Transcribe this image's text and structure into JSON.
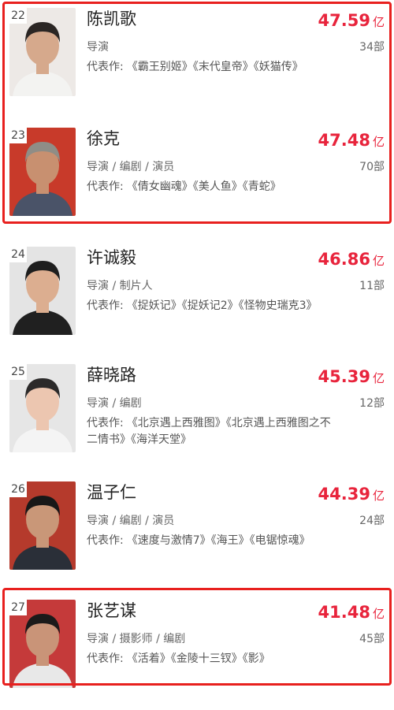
{
  "works_label": "代表作:",
  "box_office_unit": "亿",
  "highlight_color": "#e8201e",
  "value_color": "#e8243c",
  "entries": [
    {
      "rank": "22",
      "name": "陈凯歌",
      "box_office": "47.59",
      "roles": "导演",
      "count": "34部",
      "works": "《霸王别姬》《末代皇帝》《妖猫传》",
      "photo_bg": "#ede9e6",
      "hair": "#2b2624",
      "skin": "#d6a98c",
      "shirt": "#f3f3f1"
    },
    {
      "rank": "23",
      "name": "徐克",
      "box_office": "47.48",
      "roles": "导演 / 编剧 / 演员",
      "count": "70部",
      "works": "《倩女幽魂》《美人鱼》《青蛇》",
      "photo_bg": "#c83a2a",
      "hair": "#8f8d86",
      "skin": "#c89070",
      "shirt": "#4a5368"
    },
    {
      "rank": "24",
      "name": "许诚毅",
      "box_office": "46.86",
      "roles": "导演 / 制片人",
      "count": "11部",
      "works": "《捉妖记》《捉妖记2》《怪物史瑞克3》",
      "photo_bg": "#e4e4e4",
      "hair": "#1e1e1e",
      "skin": "#dcae90",
      "shirt": "#202020"
    },
    {
      "rank": "25",
      "name": "薛晓路",
      "box_office": "45.39",
      "roles": "导演 / 编剧",
      "count": "12部",
      "works": "《北京遇上西雅图》《北京遇上西雅图之不二情书》《海洋天堂》",
      "photo_bg": "#e6e6e6",
      "hair": "#2c2a2a",
      "skin": "#ecc6b0",
      "shirt": "#f4f4f4"
    },
    {
      "rank": "26",
      "name": "温子仁",
      "box_office": "44.39",
      "roles": "导演 / 编剧 / 演员",
      "count": "24部",
      "works": "《速度与激情7》《海王》《电锯惊魂》",
      "photo_bg": "#b53a2c",
      "hair": "#181818",
      "skin": "#c99778",
      "shirt": "#2a2f38"
    },
    {
      "rank": "27",
      "name": "张艺谋",
      "box_office": "41.48",
      "roles": "导演 / 摄影师 / 编剧",
      "count": "45部",
      "works": "《活着》《金陵十三钗》《影》",
      "photo_bg": "#c53a3a",
      "hair": "#1c1a1a",
      "skin": "#c99478",
      "shirt": "#e8e8e8"
    }
  ]
}
